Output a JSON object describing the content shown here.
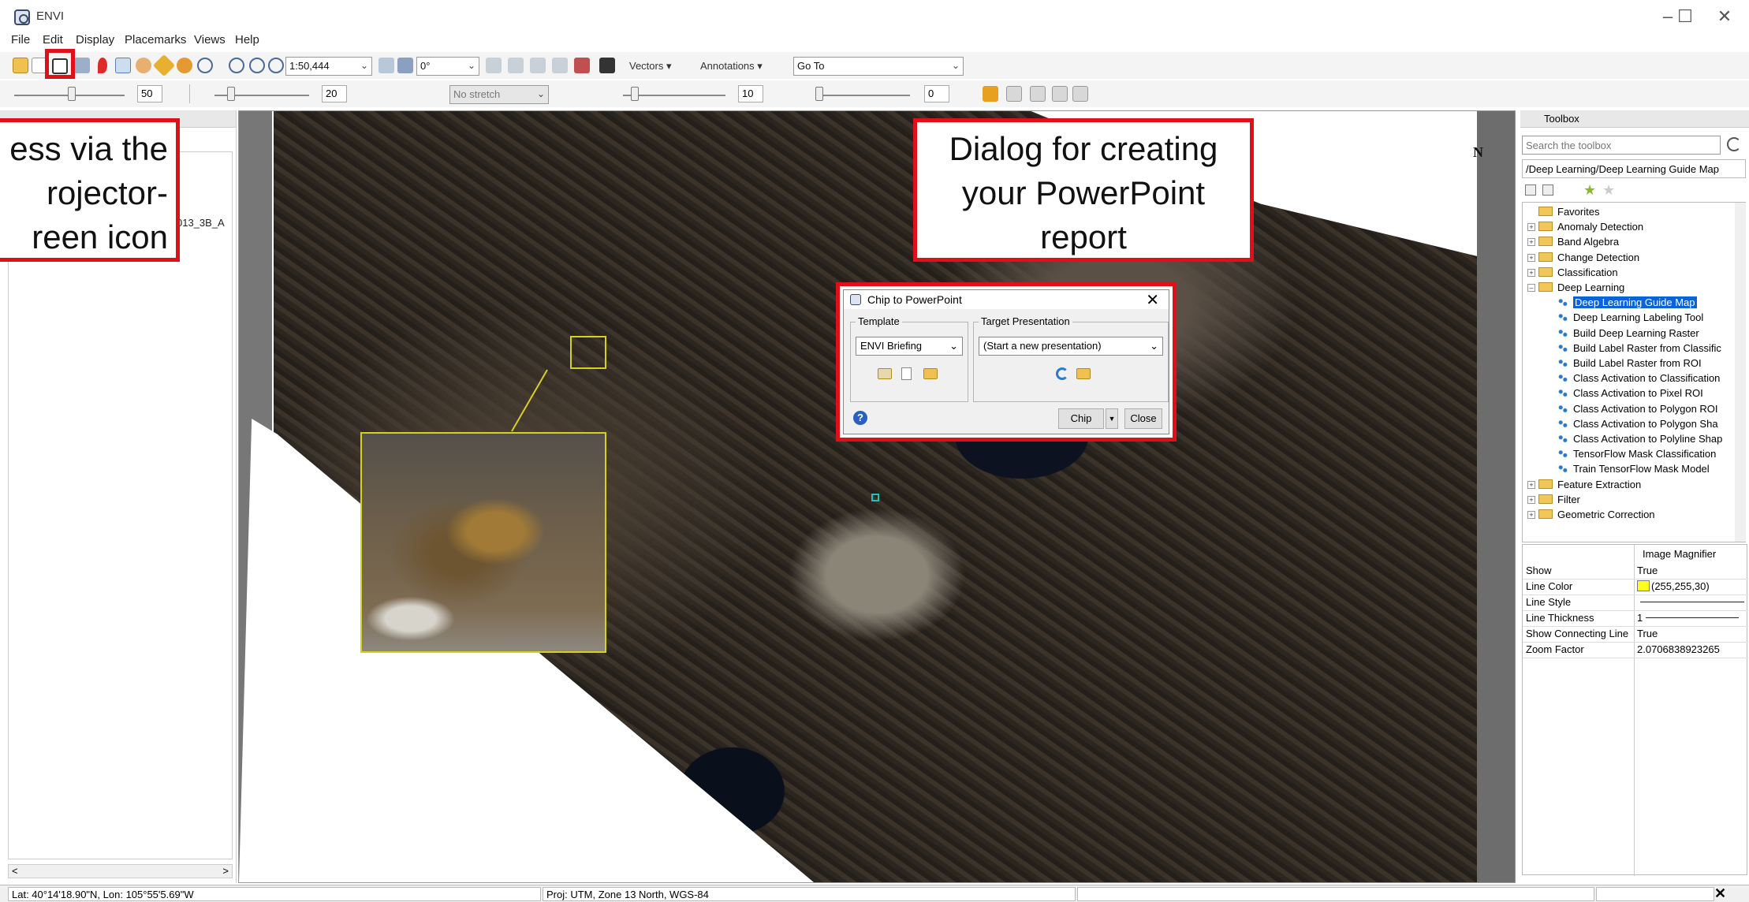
{
  "window": {
    "title": "ENVI",
    "minimize": "–",
    "maximize": "☐",
    "close": "✕"
  },
  "menu": [
    "File",
    "Edit",
    "Display",
    "Placemarks",
    "Views",
    "Help"
  ],
  "toolbar1": {
    "scale_value": "1:50,444",
    "rotation_value": "0°",
    "vectors_label": "Vectors",
    "annotations_label": "Annotations",
    "goto_value": "Go To"
  },
  "toolbar2": {
    "brightness": "50",
    "contrast": "20",
    "stretch_value": "No stretch",
    "sharpen": "10",
    "transparency": "0"
  },
  "layer_panel": {
    "layer_name_fragment": "013_3B_A",
    "scroll_left": "<",
    "scroll_right": ">"
  },
  "map": {
    "north_label": "N"
  },
  "callouts": {
    "left": [
      "ess via the",
      "rojector-",
      "reen icon"
    ],
    "right": [
      "Dialog for creating",
      "your PowerPoint",
      "report"
    ]
  },
  "dialog": {
    "title": "Chip to PowerPoint",
    "close_x": "✕",
    "template_group": "Template",
    "template_value": "ENVI Briefing",
    "target_group": "Target Presentation",
    "target_value": "(Start a new presentation)",
    "help": "?",
    "chip_button": "Chip",
    "close_button": "Close"
  },
  "toolbox": {
    "title": "Toolbox",
    "search_placeholder": "Search the toolbox",
    "path": "/Deep Learning/Deep Learning Guide Map",
    "tree": [
      {
        "label": "Favorites",
        "kind": "folder",
        "level": 0
      },
      {
        "label": "Anomaly Detection",
        "kind": "folder",
        "level": 0
      },
      {
        "label": "Band Algebra",
        "kind": "folder",
        "level": 0
      },
      {
        "label": "Change Detection",
        "kind": "folder",
        "level": 0
      },
      {
        "label": "Classification",
        "kind": "folder",
        "level": 0
      },
      {
        "label": "Deep Learning",
        "kind": "folder",
        "level": 0
      },
      {
        "label": "Deep Learning Guide Map",
        "kind": "tool",
        "level": 1,
        "selected": true
      },
      {
        "label": "Deep Learning Labeling Tool",
        "kind": "tool",
        "level": 1
      },
      {
        "label": "Build Deep Learning Raster",
        "kind": "tool",
        "level": 1
      },
      {
        "label": "Build Label Raster from Classific",
        "kind": "tool",
        "level": 1
      },
      {
        "label": "Build Label Raster from ROI",
        "kind": "tool",
        "level": 1
      },
      {
        "label": "Class Activation to Classification",
        "kind": "tool",
        "level": 1
      },
      {
        "label": "Class Activation to Pixel ROI",
        "kind": "tool",
        "level": 1
      },
      {
        "label": "Class Activation to Polygon ROI",
        "kind": "tool",
        "level": 1
      },
      {
        "label": "Class Activation to Polygon Sha",
        "kind": "tool",
        "level": 1
      },
      {
        "label": "Class Activation to Polyline Shap",
        "kind": "tool",
        "level": 1
      },
      {
        "label": "TensorFlow Mask Classification",
        "kind": "tool",
        "level": 1
      },
      {
        "label": "Train TensorFlow Mask Model",
        "kind": "tool",
        "level": 1
      },
      {
        "label": "Feature Extraction",
        "kind": "folder",
        "level": 0
      },
      {
        "label": "Filter",
        "kind": "folder",
        "level": 0
      },
      {
        "label": "Geometric Correction",
        "kind": "folder",
        "level": 0
      }
    ],
    "props_header": "Image Magnifier",
    "props": [
      {
        "key": "Show",
        "value": "True"
      },
      {
        "key": "Line Color",
        "value": "(255,255,30)"
      },
      {
        "key": "Line Style",
        "value": ""
      },
      {
        "key": "Line Thickness",
        "value": "1"
      },
      {
        "key": "Show Connecting Line",
        "value": "True"
      },
      {
        "key": "Zoom Factor",
        "value": "2.0706838923265"
      }
    ],
    "line_color_swatch": "#ffff1e"
  },
  "status": {
    "latlon": "Lat: 40°14'18.90\"N, Lon: 105°55'5.69\"W",
    "proj": "Proj: UTM, Zone 13 North, WGS-84"
  },
  "colors": {
    "callout_border": "#e0101a",
    "selection": "#0a64d8",
    "magnifier": "#d8d020"
  }
}
